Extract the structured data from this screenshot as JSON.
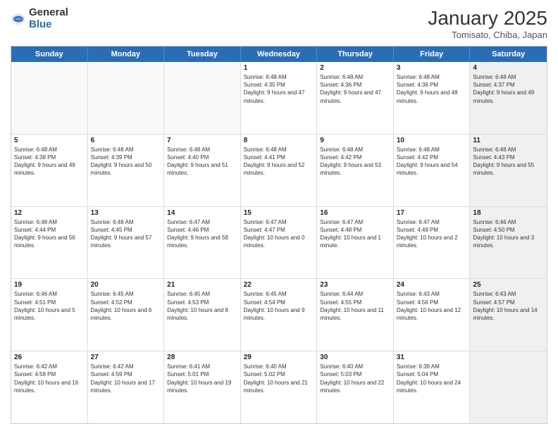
{
  "logo": {
    "general": "General",
    "blue": "Blue"
  },
  "header": {
    "month": "January 2025",
    "location": "Tomisato, Chiba, Japan"
  },
  "days": [
    "Sunday",
    "Monday",
    "Tuesday",
    "Wednesday",
    "Thursday",
    "Friday",
    "Saturday"
  ],
  "rows": [
    [
      {
        "num": "",
        "text": "",
        "empty": true
      },
      {
        "num": "",
        "text": "",
        "empty": true
      },
      {
        "num": "",
        "text": "",
        "empty": true
      },
      {
        "num": "1",
        "text": "Sunrise: 6:48 AM\nSunset: 4:35 PM\nDaylight: 9 hours and 47 minutes."
      },
      {
        "num": "2",
        "text": "Sunrise: 6:48 AM\nSunset: 4:36 PM\nDaylight: 9 hours and 47 minutes."
      },
      {
        "num": "3",
        "text": "Sunrise: 6:48 AM\nSunset: 4:36 PM\nDaylight: 9 hours and 48 minutes."
      },
      {
        "num": "4",
        "text": "Sunrise: 6:48 AM\nSunset: 4:37 PM\nDaylight: 9 hours and 49 minutes.",
        "shaded": true
      }
    ],
    [
      {
        "num": "5",
        "text": "Sunrise: 6:48 AM\nSunset: 4:38 PM\nDaylight: 9 hours and 49 minutes."
      },
      {
        "num": "6",
        "text": "Sunrise: 6:48 AM\nSunset: 4:39 PM\nDaylight: 9 hours and 50 minutes."
      },
      {
        "num": "7",
        "text": "Sunrise: 6:48 AM\nSunset: 4:40 PM\nDaylight: 9 hours and 51 minutes."
      },
      {
        "num": "8",
        "text": "Sunrise: 6:48 AM\nSunset: 4:41 PM\nDaylight: 9 hours and 52 minutes."
      },
      {
        "num": "9",
        "text": "Sunrise: 6:48 AM\nSunset: 4:42 PM\nDaylight: 9 hours and 53 minutes."
      },
      {
        "num": "10",
        "text": "Sunrise: 6:48 AM\nSunset: 4:42 PM\nDaylight: 9 hours and 54 minutes."
      },
      {
        "num": "11",
        "text": "Sunrise: 6:48 AM\nSunset: 4:43 PM\nDaylight: 9 hours and 55 minutes.",
        "shaded": true
      }
    ],
    [
      {
        "num": "12",
        "text": "Sunrise: 6:48 AM\nSunset: 4:44 PM\nDaylight: 9 hours and 56 minutes."
      },
      {
        "num": "13",
        "text": "Sunrise: 6:48 AM\nSunset: 4:45 PM\nDaylight: 9 hours and 57 minutes."
      },
      {
        "num": "14",
        "text": "Sunrise: 6:47 AM\nSunset: 4:46 PM\nDaylight: 9 hours and 58 minutes."
      },
      {
        "num": "15",
        "text": "Sunrise: 6:47 AM\nSunset: 4:47 PM\nDaylight: 10 hours and 0 minutes."
      },
      {
        "num": "16",
        "text": "Sunrise: 6:47 AM\nSunset: 4:48 PM\nDaylight: 10 hours and 1 minute."
      },
      {
        "num": "17",
        "text": "Sunrise: 6:47 AM\nSunset: 4:49 PM\nDaylight: 10 hours and 2 minutes."
      },
      {
        "num": "18",
        "text": "Sunrise: 6:46 AM\nSunset: 4:50 PM\nDaylight: 10 hours and 3 minutes.",
        "shaded": true
      }
    ],
    [
      {
        "num": "19",
        "text": "Sunrise: 6:46 AM\nSunset: 4:51 PM\nDaylight: 10 hours and 5 minutes."
      },
      {
        "num": "20",
        "text": "Sunrise: 6:45 AM\nSunset: 4:52 PM\nDaylight: 10 hours and 6 minutes."
      },
      {
        "num": "21",
        "text": "Sunrise: 6:45 AM\nSunset: 4:53 PM\nDaylight: 10 hours and 8 minutes."
      },
      {
        "num": "22",
        "text": "Sunrise: 6:45 AM\nSunset: 4:54 PM\nDaylight: 10 hours and 9 minutes."
      },
      {
        "num": "23",
        "text": "Sunrise: 6:44 AM\nSunset: 4:55 PM\nDaylight: 10 hours and 11 minutes."
      },
      {
        "num": "24",
        "text": "Sunrise: 6:43 AM\nSunset: 4:56 PM\nDaylight: 10 hours and 12 minutes."
      },
      {
        "num": "25",
        "text": "Sunrise: 6:43 AM\nSunset: 4:57 PM\nDaylight: 10 hours and 14 minutes.",
        "shaded": true
      }
    ],
    [
      {
        "num": "26",
        "text": "Sunrise: 6:42 AM\nSunset: 4:58 PM\nDaylight: 10 hours and 16 minutes."
      },
      {
        "num": "27",
        "text": "Sunrise: 6:42 AM\nSunset: 4:59 PM\nDaylight: 10 hours and 17 minutes."
      },
      {
        "num": "28",
        "text": "Sunrise: 6:41 AM\nSunset: 5:01 PM\nDaylight: 10 hours and 19 minutes."
      },
      {
        "num": "29",
        "text": "Sunrise: 6:40 AM\nSunset: 5:02 PM\nDaylight: 10 hours and 21 minutes."
      },
      {
        "num": "30",
        "text": "Sunrise: 6:40 AM\nSunset: 5:03 PM\nDaylight: 10 hours and 22 minutes."
      },
      {
        "num": "31",
        "text": "Sunrise: 6:39 AM\nSunset: 5:04 PM\nDaylight: 10 hours and 24 minutes."
      },
      {
        "num": "",
        "text": "",
        "empty": true,
        "shaded": true
      }
    ]
  ]
}
